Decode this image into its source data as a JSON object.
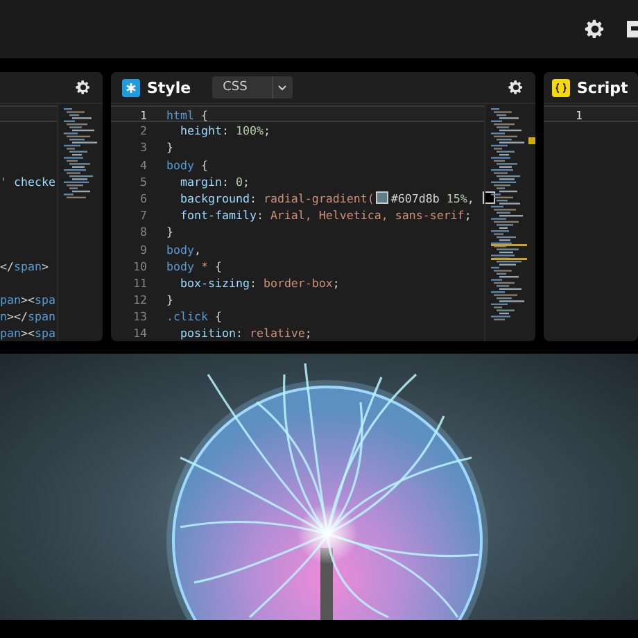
{
  "panels": [
    {
      "kind": "html",
      "settings_button": true,
      "lines": [
        {
          "current": true
        },
        {
          "current": false
        },
        {
          "current": false
        },
        {
          "current": false
        },
        {
          "current": false,
          "tokens": [
            {
              "kind": "value",
              "text": "'"
            },
            {
              "kind": "prop",
              "text": " checke"
            }
          ]
        },
        {
          "current": false
        },
        {
          "current": false
        },
        {
          "current": false
        },
        {
          "current": false
        },
        {
          "current": false,
          "tokens": [
            {
              "kind": "punct",
              "text": "</"
            },
            {
              "kind": "selector",
              "text": "span"
            },
            {
              "kind": "punct",
              "text": ">"
            }
          ]
        },
        {
          "current": false
        },
        {
          "current": false,
          "tokens": [
            {
              "kind": "selector",
              "text": "pan"
            },
            {
              "kind": "punct",
              "text": "><"
            },
            {
              "kind": "selector",
              "text": "spa"
            }
          ]
        },
        {
          "current": false,
          "tokens": [
            {
              "kind": "selector",
              "text": "n"
            },
            {
              "kind": "punct",
              "text": "></"
            },
            {
              "kind": "selector",
              "text": "span"
            }
          ]
        },
        {
          "current": false,
          "tokens": [
            {
              "kind": "selector",
              "text": "pan"
            },
            {
              "kind": "punct",
              "text": "><"
            },
            {
              "kind": "selector",
              "text": "spa"
            }
          ]
        }
      ]
    },
    {
      "kind": "css",
      "title": "Style",
      "language": "CSS",
      "settings_button": true,
      "lines": [
        {
          "number": "1",
          "current": true,
          "tokens": [
            {
              "kind": "selector",
              "text": "html"
            },
            {
              "kind": "punct",
              "text": " {"
            }
          ]
        },
        {
          "number": "2",
          "current": false,
          "tokens": [
            {
              "kind": "prop",
              "text": "  height"
            },
            {
              "kind": "punct",
              "text": ": "
            },
            {
              "kind": "number",
              "text": "100%"
            },
            {
              "kind": "punct",
              "text": ";"
            }
          ]
        },
        {
          "number": "3",
          "current": false,
          "tokens": [
            {
              "kind": "punct",
              "text": "}"
            }
          ]
        },
        {
          "number": "4",
          "current": false,
          "tokens": [
            {
              "kind": "selector",
              "text": "body"
            },
            {
              "kind": "punct",
              "text": " {"
            }
          ]
        },
        {
          "number": "5",
          "current": false,
          "tokens": [
            {
              "kind": "prop",
              "text": "  margin"
            },
            {
              "kind": "punct",
              "text": ": "
            },
            {
              "kind": "number",
              "text": "0"
            },
            {
              "kind": "punct",
              "text": ";"
            }
          ]
        },
        {
          "number": "6",
          "current": false,
          "tokens": [
            {
              "kind": "prop",
              "text": "  background"
            },
            {
              "kind": "punct",
              "text": ": "
            },
            {
              "kind": "value",
              "text": "radial-gradient("
            },
            {
              "kind": "swatch",
              "color": "#607d8b"
            },
            {
              "kind": "punct",
              "text": "#607d8b "
            },
            {
              "kind": "number",
              "text": "15%"
            },
            {
              "kind": "punct",
              "text": ", "
            },
            {
              "kind": "swatch",
              "color": "#000000"
            }
          ]
        },
        {
          "number": "7",
          "current": false,
          "tokens": [
            {
              "kind": "prop",
              "text": "  font-family"
            },
            {
              "kind": "punct",
              "text": ": "
            },
            {
              "kind": "value",
              "text": "Arial, Helvetica, sans-serif"
            },
            {
              "kind": "punct",
              "text": ";"
            }
          ]
        },
        {
          "number": "8",
          "current": false,
          "tokens": [
            {
              "kind": "punct",
              "text": "}"
            }
          ]
        },
        {
          "number": "9",
          "current": false,
          "tokens": [
            {
              "kind": "selector",
              "text": "body"
            },
            {
              "kind": "punct",
              "text": ","
            }
          ]
        },
        {
          "number": "10",
          "current": false,
          "tokens": [
            {
              "kind": "selector",
              "text": "body "
            },
            {
              "kind": "value",
              "text": "*"
            },
            {
              "kind": "punct",
              "text": " {"
            }
          ]
        },
        {
          "number": "11",
          "current": false,
          "tokens": [
            {
              "kind": "prop",
              "text": "  box-sizing"
            },
            {
              "kind": "punct",
              "text": ": "
            },
            {
              "kind": "value",
              "text": "border-box"
            },
            {
              "kind": "punct",
              "text": ";"
            }
          ]
        },
        {
          "number": "12",
          "current": false,
          "tokens": [
            {
              "kind": "punct",
              "text": "}"
            }
          ]
        },
        {
          "number": "13",
          "current": false,
          "tokens": [
            {
              "kind": "selector",
              "text": ".click"
            },
            {
              "kind": "punct",
              "text": " {"
            }
          ]
        },
        {
          "number": "14",
          "current": false,
          "tokens": [
            {
              "kind": "prop",
              "text": "  position"
            },
            {
              "kind": "punct",
              "text": ": "
            },
            {
              "kind": "value",
              "text": "relative"
            },
            {
              "kind": "punct",
              "text": ";"
            }
          ]
        }
      ]
    },
    {
      "kind": "js",
      "title": "Script",
      "settings_button": false,
      "lines": [
        {
          "number": "1",
          "current": true
        }
      ]
    }
  ]
}
